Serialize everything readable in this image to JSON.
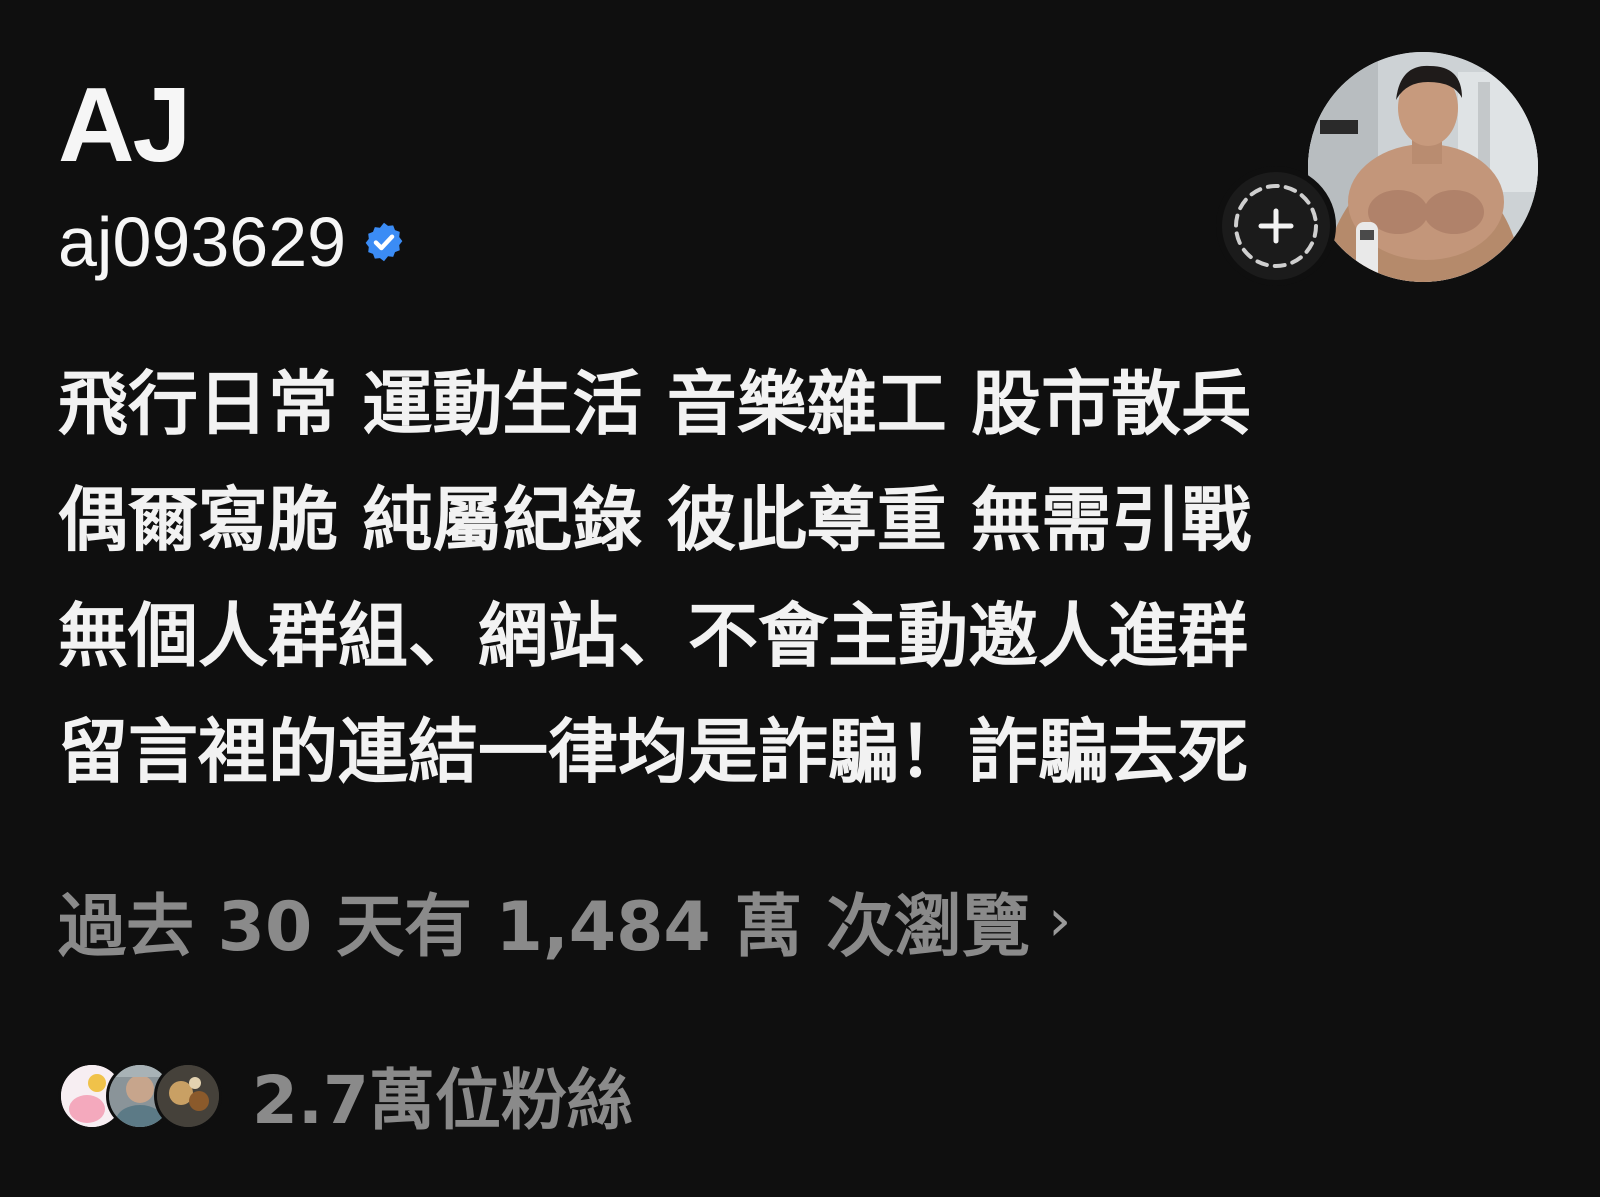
{
  "profile": {
    "display_name": "AJ",
    "handle": "aj093629",
    "verified_icon": "verified-badge-icon",
    "accent_color": "#3b8cf5"
  },
  "bio": {
    "lines": [
      "飛行日常 運動生活 音樂雜工 股市散兵",
      "偶爾寫脆 純屬紀錄 彼此尊重 無需引戰",
      "無個人群組、網站、不會主動邀人進群",
      "留言裡的連結一律均是詐騙！詐騙去死"
    ]
  },
  "insights": {
    "views_text": "過去 30 天有 1,484 萬 次瀏覽",
    "chevron": "›"
  },
  "followers": {
    "text": "2.7萬位粉絲"
  }
}
